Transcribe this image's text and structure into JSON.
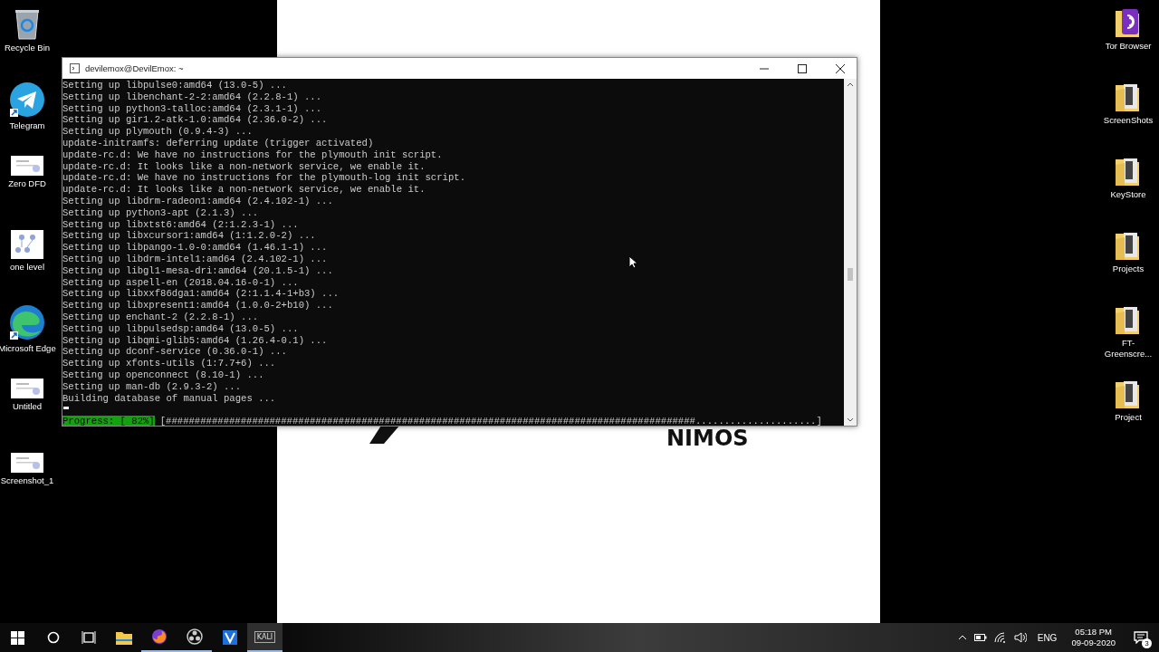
{
  "desktop_icons_left": [
    {
      "label": "Recycle Bin",
      "kind": "recycle"
    },
    {
      "label": "Telegram",
      "kind": "telegram"
    },
    {
      "label": "Zero DFD",
      "kind": "document"
    },
    {
      "label": "one level",
      "kind": "diagram"
    },
    {
      "label": "Microsoft Edge",
      "kind": "edge"
    },
    {
      "label": "Untitled",
      "kind": "document"
    },
    {
      "label": "Screenshot_1",
      "kind": "document"
    }
  ],
  "desktop_icons_right": [
    {
      "label": "Tor Browser",
      "kind": "tor"
    },
    {
      "label": "ScreenShots",
      "kind": "folder"
    },
    {
      "label": "KeyStore",
      "kind": "folder"
    },
    {
      "label": "Projects",
      "kind": "folder"
    },
    {
      "label": "FT-Greenscre...",
      "kind": "folder"
    },
    {
      "label": "Project",
      "kind": "folder"
    }
  ],
  "background_window": {
    "logo_text": "NIMOS"
  },
  "terminal": {
    "title": "devilemox@DevilEmox: ~",
    "lines": [
      "Setting up libpulse0:amd64 (13.0-5) ...",
      "Setting up libenchant-2-2:amd64 (2.2.8-1) ...",
      "Setting up python3-talloc:amd64 (2.3.1-1) ...",
      "Setting up gir1.2-atk-1.0:amd64 (2.36.0-2) ...",
      "Setting up plymouth (0.9.4-3) ...",
      "update-initramfs: deferring update (trigger activated)",
      "update-rc.d: We have no instructions for the plymouth init script.",
      "update-rc.d: It looks like a non-network service, we enable it.",
      "update-rc.d: We have no instructions for the plymouth-log init script.",
      "update-rc.d: It looks like a non-network service, we enable it.",
      "Setting up libdrm-radeon1:amd64 (2.4.102-1) ...",
      "Setting up python3-apt (2.1.3) ...",
      "Setting up libxtst6:amd64 (2:1.2.3-1) ...",
      "Setting up libxcursor1:amd64 (1:1.2.0-2) ...",
      "Setting up libpango-1.0-0:amd64 (1.46.1-1) ...",
      "Setting up libdrm-intel1:amd64 (2.4.102-1) ...",
      "Setting up libgl1-mesa-dri:amd64 (20.1.5-1) ...",
      "Setting up aspell-en (2018.04.16-0-1) ...",
      "Setting up libxxf86dga1:amd64 (2:1.1.4-1+b3) ...",
      "Setting up libxpresent1:amd64 (1.0.0-2+b10) ...",
      "Setting up enchant-2 (2.2.8-1) ...",
      "Setting up libpulsedsp:amd64 (13.0-5) ...",
      "Setting up libqmi-glib5:amd64 (1.26.4-0.1) ...",
      "Setting up dconf-service (0.36.0-1) ...",
      "Setting up xfonts-utils (1:7.7+6) ...",
      "Setting up openconnect (8.10-1) ...",
      "Setting up man-db (2.9.3-2) ...",
      "Building database of manual pages ..."
    ],
    "progress": {
      "label": "Progress: [ 82%]",
      "bar": "[############################################################################################.....................]"
    }
  },
  "taskbar": {
    "apps": [
      {
        "kind": "start",
        "running": false,
        "selected": false
      },
      {
        "kind": "search",
        "running": false,
        "selected": false
      },
      {
        "kind": "taskview",
        "running": false,
        "selected": false
      },
      {
        "kind": "explorer",
        "running": false,
        "selected": false
      },
      {
        "kind": "firefox",
        "running": true,
        "selected": false
      },
      {
        "kind": "obs",
        "running": true,
        "selected": false
      },
      {
        "kind": "vapp",
        "running": false,
        "selected": false
      },
      {
        "kind": "kali",
        "label": "KALI",
        "running": true,
        "selected": true
      }
    ],
    "tray": {
      "language": "ENG",
      "time": "05:18 PM",
      "date": "09-09-2020",
      "notifications": "3"
    }
  }
}
